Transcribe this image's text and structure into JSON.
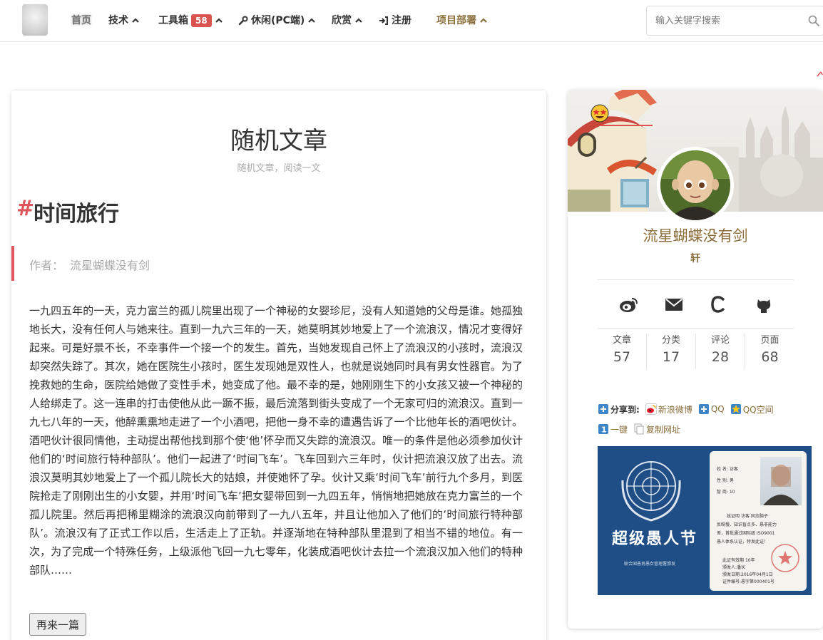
{
  "nav": {
    "home": "首页",
    "tech": "技术",
    "toolbox": "工具箱",
    "toolbox_badge": "58",
    "leisure": "休闲(PC端)",
    "appreciate": "欣赏",
    "register": "注册",
    "project": "项目部署"
  },
  "search": {
    "placeholder": "输入关键字搜索",
    "icon": "search-icon"
  },
  "main": {
    "page_title": "随机文章",
    "page_subtitle": "随机文章，阅读一文",
    "title_hash": "#",
    "article_title": "时间旅行",
    "author_label": "作者：",
    "author_name": "流星蝴蝶没有剑",
    "body": "一九四五年的一天，克力富兰的孤儿院里出现了一个神秘的女婴珍尼，没有人知道她的父母是谁。她孤独地长大，没有任何人与她来往。直到一九六三年的一天，她莫明其妙地爱上了一个流浪汉，情况才变得好起来。可是好景不长，不幸事件一个接一个的发生。首先，当她发现自己怀上了流浪汉的小孩时，流浪汉却突然失踪了。其次，她在医院生小孩时，医生发现她是双性人，也就是说她同时具有男女性器官。为了挽救她的生命，医院给她做了变性手术，她变成了他。最不幸的是，她刚刚生下的小女孩又被一个神秘的人给绑走了。这一连串的打击使他从此一蹶不振，最后流落到街头变成了一个无家可归的流浪汉。直到一九七八年的一天，他醉熏熏地走进了一个小酒吧，把他一身不幸的遭遇告诉了一个比他年长的酒吧伙计。酒吧伙计很同情他，主动提出帮他找到那个使‘他’怀孕而又失踪的流浪汉。唯一的条件是他必须参加伙计他们的‘时间旅行特种部队’。他们一起进了‘时间飞车’。飞车回到六三年时，伙计把流浪汉放了出去。流浪汉莫明其妙地爱上了一个孤儿院长大的姑娘，并使她怀了孕。伙计又乘‘时间飞车’前行九个多月，到医院抢走了刚刚出生的小女婴，并用‘时间飞车’把女婴带回到一九四五年，悄悄地把她放在克力富兰的一个孤儿院里。然后再把稀里糊涂的流浪汉向前带到了一九八五年，并且让他加入了他们的‘时间旅行特种部队’。流浪汉有了正式工作以后，生活走上了正轨。并逐渐地在特种部队里混到了相当不错的地位。有一次，为了完成一个特殊任务，上级派他飞回一九七零年，化装成酒吧伙计去拉一个流浪汉加入他们的特种部队……",
    "more_button": "再来一篇"
  },
  "profile": {
    "name": "流星蝴蝶没有剑",
    "motto": "轩",
    "social_icons": [
      "weibo-icon",
      "mail-icon",
      "csdn-icon",
      "github-icon"
    ],
    "stats": [
      {
        "label": "文章",
        "value": "57"
      },
      {
        "label": "分类",
        "value": "17"
      },
      {
        "label": "评论",
        "value": "28"
      },
      {
        "label": "页面",
        "value": "68"
      }
    ]
  },
  "share": {
    "label": "分享到:",
    "weibo": "新浪微博",
    "qq": "QQ",
    "qzone": "QQ空间",
    "one_key": "一键",
    "copy_url": "复制网址"
  },
  "promo": {
    "title": "超级愚人节",
    "subtitle": "联合国愚男愚女管理署颁发",
    "id_name_label": "姓 名:",
    "id_name": "访客",
    "id_gender_label": "性 别:",
    "id_gender": "男",
    "id_iq_label": "智 商:",
    "id_iq": "10",
    "id_cert_line1": "兹证明",
    "id_cert_line1b": "访客",
    "id_cert_line1c": "同志脑子",
    "id_cert_line2": "反映慢、知识盲点多、悬非能力",
    "id_cert_line3": "差，首批通过国际级 ISO9001",
    "id_cert_line4": "愚人体系认证，特发此证！",
    "id_valid": "此证有效期",
    "id_valid_value": "10年",
    "id_issuer": "颁发人:潘长",
    "id_date": "颁发日期:2016年04月1日",
    "id_number": "证件编号:愚字第000401号"
  }
}
